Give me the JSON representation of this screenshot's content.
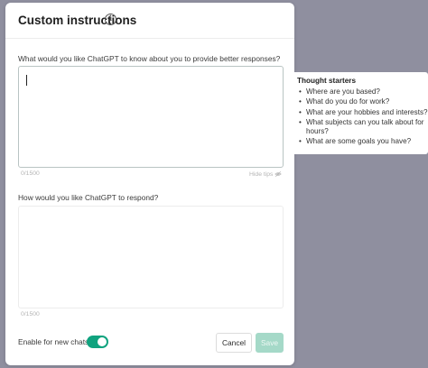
{
  "modal": {
    "title": "Custom instructions",
    "field1": {
      "label": "What would you like ChatGPT to know about you to provide better responses?",
      "value": "",
      "counter": "0/1500",
      "hide_tips_label": "Hide tips"
    },
    "field2": {
      "label": "How would you like ChatGPT to respond?",
      "value": "",
      "counter": "0/1500"
    },
    "toggle": {
      "label": "Enable for new chats",
      "enabled": true
    },
    "buttons": {
      "cancel": "Cancel",
      "save": "Save"
    }
  },
  "tips": {
    "title": "Thought starters",
    "items": [
      "Where are you based?",
      "What do you do for work?",
      "What are your hobbies and interests?",
      "What subjects can you talk about for hours?",
      "What are some goals you have?"
    ]
  },
  "colors": {
    "overlay": "#8f8f9f",
    "accent": "#10a37f",
    "save_disabled": "#a5d9c8"
  },
  "icons": {
    "title_info": "info-icon",
    "hide_tips": "eye-off-icon"
  }
}
